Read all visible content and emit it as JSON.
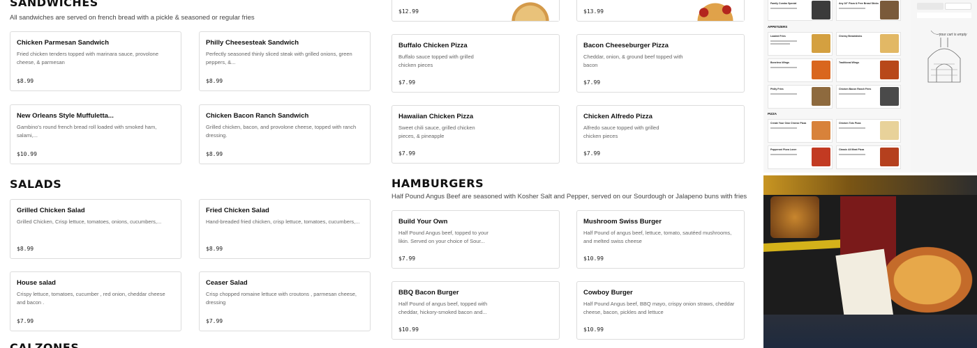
{
  "sandwiches": {
    "title": "SANDWICHES",
    "subtitle": "All sandwiches are served on french bread with a pickle & seasoned or regular fries",
    "items": [
      {
        "name": "Chicken Parmesan Sandwich",
        "desc": "Fried chicken tenders topped with marinara sauce, provolone cheese, & parmesan",
        "price": "$8.99"
      },
      {
        "name": "Philly Cheesesteak Sandwich",
        "desc": "Perfectly seasoned thinly sliced steak with grilled onions, green peppers, &...",
        "price": "$8.99"
      },
      {
        "name": "New Orleans Style Muffuletta...",
        "desc": "Gambino's round french bread roll loaded with smoked ham, salami,...",
        "price": "$10.99"
      },
      {
        "name": "Chicken Bacon Ranch Sandwich",
        "desc": "Grilled chicken, bacon, and provolone cheese, topped with ranch dressing.",
        "price": "$8.99"
      }
    ]
  },
  "salads": {
    "title": "SALADS",
    "items": [
      {
        "name": "Grilled Chicken Salad",
        "desc": "Grilled Chicken, Crisp lettuce, tomatoes, onions, cucumbers,...",
        "price": "$8.99"
      },
      {
        "name": "Fried Chicken Salad",
        "desc": "Hand-breaded fried chicken, crisp lettuce, tomatoes, cucumbers,...",
        "price": "$8.99"
      },
      {
        "name": "House salad",
        "desc": "Crispy lettuce, tomatoes, cucumber , red onion, cheddar cheese and bacon .",
        "price": "$7.99"
      },
      {
        "name": "Ceaser Salad",
        "desc": "Crisp chopped romaine lettuce with croutons , parmesan cheese, dressing",
        "price": "$7.99"
      }
    ]
  },
  "calzones": {
    "title": "CALZONES"
  },
  "pizzas": {
    "top_prices": [
      "$12.99",
      "$13.99"
    ],
    "items": [
      {
        "name": "Buffalo Chicken Pizza",
        "desc": "Buffalo sauce topped with grilled chicken pieces",
        "price": "$7.99"
      },
      {
        "name": "Bacon Cheeseburger Pizza",
        "desc": "Cheddar, onion, & ground beef topped with bacon",
        "price": "$7.99"
      },
      {
        "name": "Hawaiian Chicken Pizza",
        "desc": "Sweet chili sauce, grilled chicken pieces, & pineapple",
        "price": "$7.99"
      },
      {
        "name": "Chicken Alfredo Pizza",
        "desc": "Alfredo sauce topped with grilled chicken pieces",
        "price": "$7.99"
      }
    ]
  },
  "hamburgers": {
    "title": "HAMBURGERS",
    "subtitle": "Half Pound Angus Beef are seasoned with Kosher Salt and Pepper, served on our Sourdough or Jalapeno buns with fries",
    "items": [
      {
        "name": "Build Your Own",
        "desc": "Half Pound Angus beef, topped to your likin. Served on your choice of Sour...",
        "price": "$7.99"
      },
      {
        "name": "Mushroom Swiss Burger",
        "desc": "Half Pound of angus beef, lettuce, tomato, sautéed mushrooms, and melted swiss cheese",
        "price": "$10.99"
      },
      {
        "name": "BBQ Bacon Burger",
        "desc": "Half Pound of angus beef, topped with cheddar, hickory-smoked bacon and...",
        "price": "$10.99"
      },
      {
        "name": "Cowboy Burger",
        "desc": "Half Pound Angus beef, BBQ mayo, crispy onion straws, cheddar cheese, bacon, pickles and lettuce",
        "price": "$10.99"
      }
    ]
  },
  "menu_preview": {
    "appetizers_heading": "APPETIZERS",
    "pizza_heading": "PIZZA",
    "cells": [
      "Family Combo Special",
      "Any 16\" Pizza & Free Bread Sticks",
      "Loaded Fries",
      "Cheesy Breadsticks",
      "Boneless Wings",
      "Traditional Wings",
      "Philly Fries",
      "Chicken Bacon Ranch Fries",
      "Create Your Own Cheese Pizza",
      "Chicken Tots Pizza",
      "Pepperoni Pizza Lover",
      "Classic All Meat Pizza"
    ]
  },
  "side_panel": {
    "note": "your cart is empty"
  },
  "colors": {
    "accent": "#111111",
    "card_border": "#dcdcdc",
    "muted_text": "#666666"
  }
}
